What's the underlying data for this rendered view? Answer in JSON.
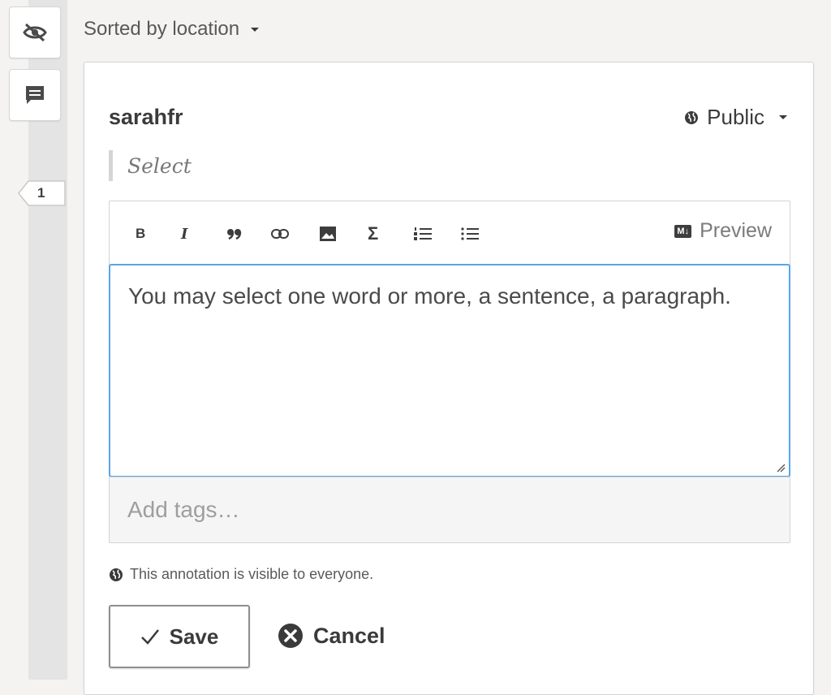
{
  "sidebar": {
    "hide_button_icon": "eye-slash-icon",
    "annotations_button_icon": "comment-icon",
    "bucket_count": "1"
  },
  "sort": {
    "label": "Sorted by location"
  },
  "annotation": {
    "username": "sarahfr",
    "privacy_label": "Public",
    "quote": "Select",
    "toolbar": {
      "bold": "B",
      "italic": "I",
      "preview_label": "Preview",
      "markdown_badge": "M↓"
    },
    "body_text": "You may select one word or more, a sentence, a paragraph.",
    "tags_placeholder": "Add tags…",
    "visibility_notice": "This annotation is visible to everyone.",
    "save_label": "Save",
    "cancel_label": "Cancel"
  },
  "colors": {
    "focus_border": "#5aa6e6",
    "background": "#f4f3f1"
  }
}
